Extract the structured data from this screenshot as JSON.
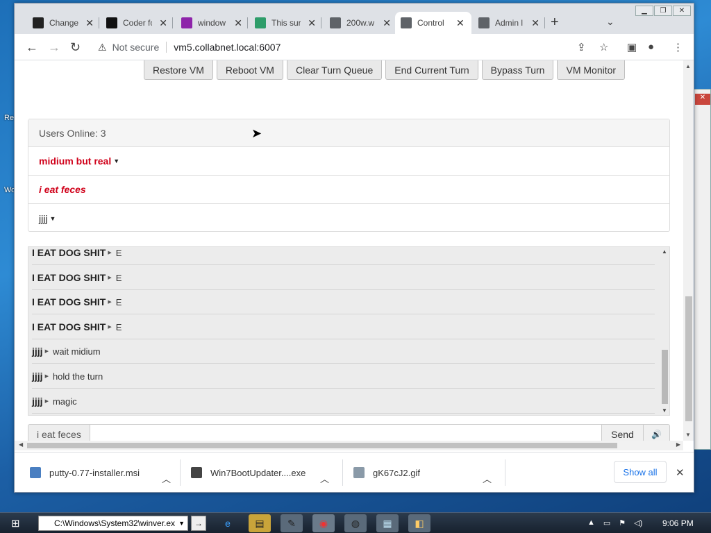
{
  "browser": {
    "tabs": [
      {
        "title": "Change",
        "color": "#222"
      },
      {
        "title": "Coder fc",
        "color": "#111"
      },
      {
        "title": "window",
        "color": "#8e24aa"
      },
      {
        "title": "This sur",
        "color": "#2e9d6a"
      },
      {
        "title": "200w.w",
        "color": "#5f6368"
      },
      {
        "title": "Control",
        "color": "#5f6368",
        "active": true
      },
      {
        "title": "Admin l",
        "color": "#5f6368"
      }
    ],
    "new_tab": "+",
    "security_label": "Not secure",
    "url": "vm5.collabnet.local:6007"
  },
  "vm_buttons": [
    "Restore VM",
    "Reboot VM",
    "Clear Turn Queue",
    "End Current Turn",
    "Bypass Turn",
    "VM Monitor"
  ],
  "users_panel": {
    "header": "Users Online: 3",
    "users": [
      {
        "name": "midium but real",
        "style": "red"
      },
      {
        "name": "i eat feces",
        "style": "red-italic"
      },
      {
        "name": "jjjj",
        "style": "plain"
      }
    ]
  },
  "chat": {
    "messages": [
      {
        "user": "I EAT DOG SHIT",
        "text": "E"
      },
      {
        "user": "I EAT DOG SHIT",
        "text": "E"
      },
      {
        "user": "I EAT DOG SHIT",
        "text": "E"
      },
      {
        "user": "I EAT DOG SHIT",
        "text": "E"
      },
      {
        "user": "jjjj",
        "text": "wait midium"
      },
      {
        "user": "jjjj",
        "text": "hold the turn"
      },
      {
        "user": "jjjj",
        "text": "magic"
      }
    ]
  },
  "chat_input": {
    "username": "i eat feces",
    "value": "",
    "send_label": "Send"
  },
  "downloads": {
    "items": [
      "putty-0.77-installer.msi",
      "Win7BootUpdater....exe",
      "gK67cJ2.gif"
    ],
    "show_all": "Show all"
  },
  "taskbar": {
    "run_path": "C:\\Windows\\System32\\winver.ex",
    "clock": "9:06 PM"
  }
}
